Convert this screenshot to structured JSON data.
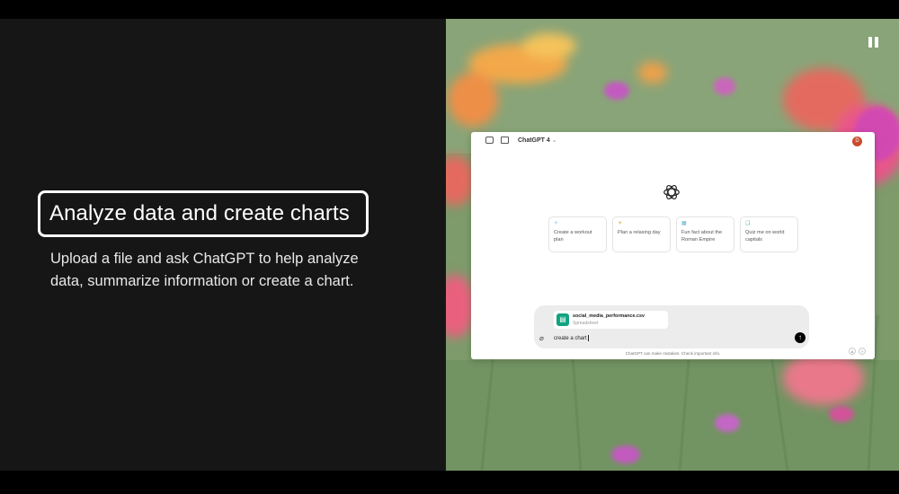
{
  "feature": {
    "title": "Analyze data and create charts",
    "description": "Upload a file and ask ChatGPT to help analyze data, summarize information or create a chart."
  },
  "media": {
    "pause_icon": "pause-icon",
    "app": {
      "model_label": "ChatGPT 4",
      "avatar_initial": "D",
      "suggestions": [
        {
          "icon": "sparkle",
          "text": "Create a workout plan"
        },
        {
          "icon": "sun",
          "text": "Plan a relaxing day"
        },
        {
          "icon": "calendar",
          "text": "Fun fact about the Roman Empire"
        },
        {
          "icon": "book",
          "text": "Quiz me on world capitals"
        }
      ],
      "attachment": {
        "filename": "social_media_performance.csv",
        "filetype": "Spreadsheet"
      },
      "composer_text": "create a chart",
      "disclaimer": "ChatGPT can make mistakes. Check important info."
    }
  },
  "colors": {
    "background": "#161616",
    "accent_green": "#10a37f",
    "avatar": "#c94a2e"
  }
}
